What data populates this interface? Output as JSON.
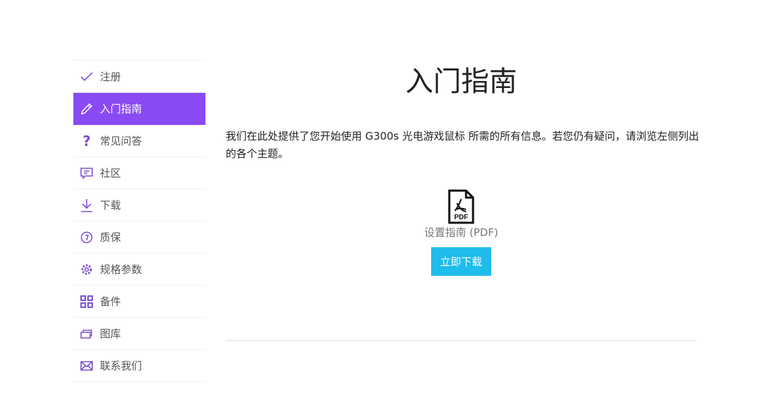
{
  "sidebar": {
    "items": [
      {
        "label": "注册",
        "icon": "check-icon"
      },
      {
        "label": "入门指南",
        "icon": "pencil-icon",
        "active": true
      },
      {
        "label": "常见问答",
        "icon": "question-icon"
      },
      {
        "label": "社区",
        "icon": "chat-icon"
      },
      {
        "label": "下载",
        "icon": "download-icon"
      },
      {
        "label": "质保",
        "icon": "warranty-icon"
      },
      {
        "label": "规格参数",
        "icon": "gear-icon"
      },
      {
        "label": "备件",
        "icon": "grid-icon"
      },
      {
        "label": "图库",
        "icon": "gallery-icon"
      },
      {
        "label": "联系我们",
        "icon": "mail-icon"
      }
    ]
  },
  "main": {
    "title": "入门指南",
    "description": "我们在此处提供了您开始使用 G300s 光电游戏鼠标 所需的所有信息。若您仍有疑问，请浏览左侧列出的各个主题。",
    "pdf_icon_text": "PDF",
    "pdf_label": "设置指南 (PDF)",
    "download_button": "立即下载"
  },
  "colors": {
    "accent": "#8a4af3",
    "button": "#1fbcec"
  }
}
